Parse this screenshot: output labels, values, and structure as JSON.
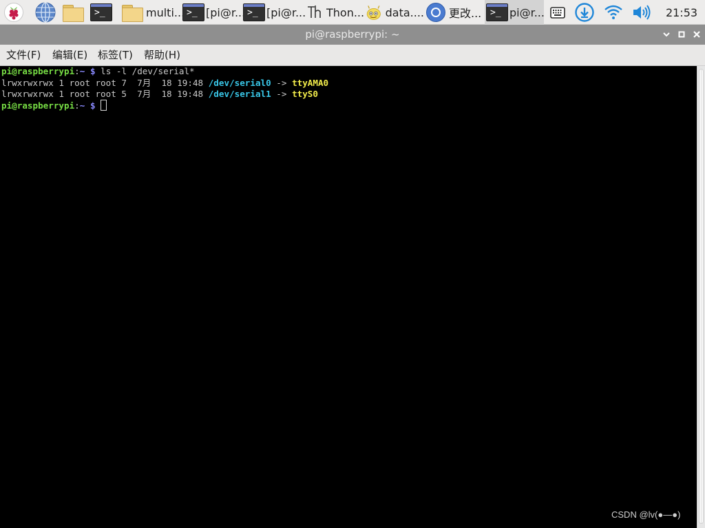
{
  "taskbar": {
    "items": [
      {
        "label": "multi..."
      },
      {
        "label": "[pi@r..."
      },
      {
        "label": "[pi@r..."
      },
      {
        "label": "Thon..."
      },
      {
        "label": "data...."
      },
      {
        "label": "更改..."
      },
      {
        "label": "pi@r..."
      }
    ],
    "clock": "21:53"
  },
  "window": {
    "title": "pi@raspberrypi: ~"
  },
  "menu": [
    "文件(F)",
    "编辑(E)",
    "标签(T)",
    "帮助(H)"
  ],
  "terminal": {
    "prompt_user": "pi@raspberrypi",
    "prompt_sep": ":",
    "prompt_path": "~",
    "prompt_sym": "$",
    "command": "ls -l /dev/serial*",
    "rows": [
      {
        "meta": "lrwxrwxrwx 1 root root 7  7月  18 19:48 ",
        "path": "/dev/serial0",
        "arrow": " -> ",
        "target": "ttyAMA0"
      },
      {
        "meta": "lrwxrwxrwx 1 root root 5  7月  18 19:48 ",
        "path": "/dev/serial1",
        "arrow": " -> ",
        "target": "ttyS0"
      }
    ]
  },
  "watermark": "CSDN @lv(●—●)"
}
